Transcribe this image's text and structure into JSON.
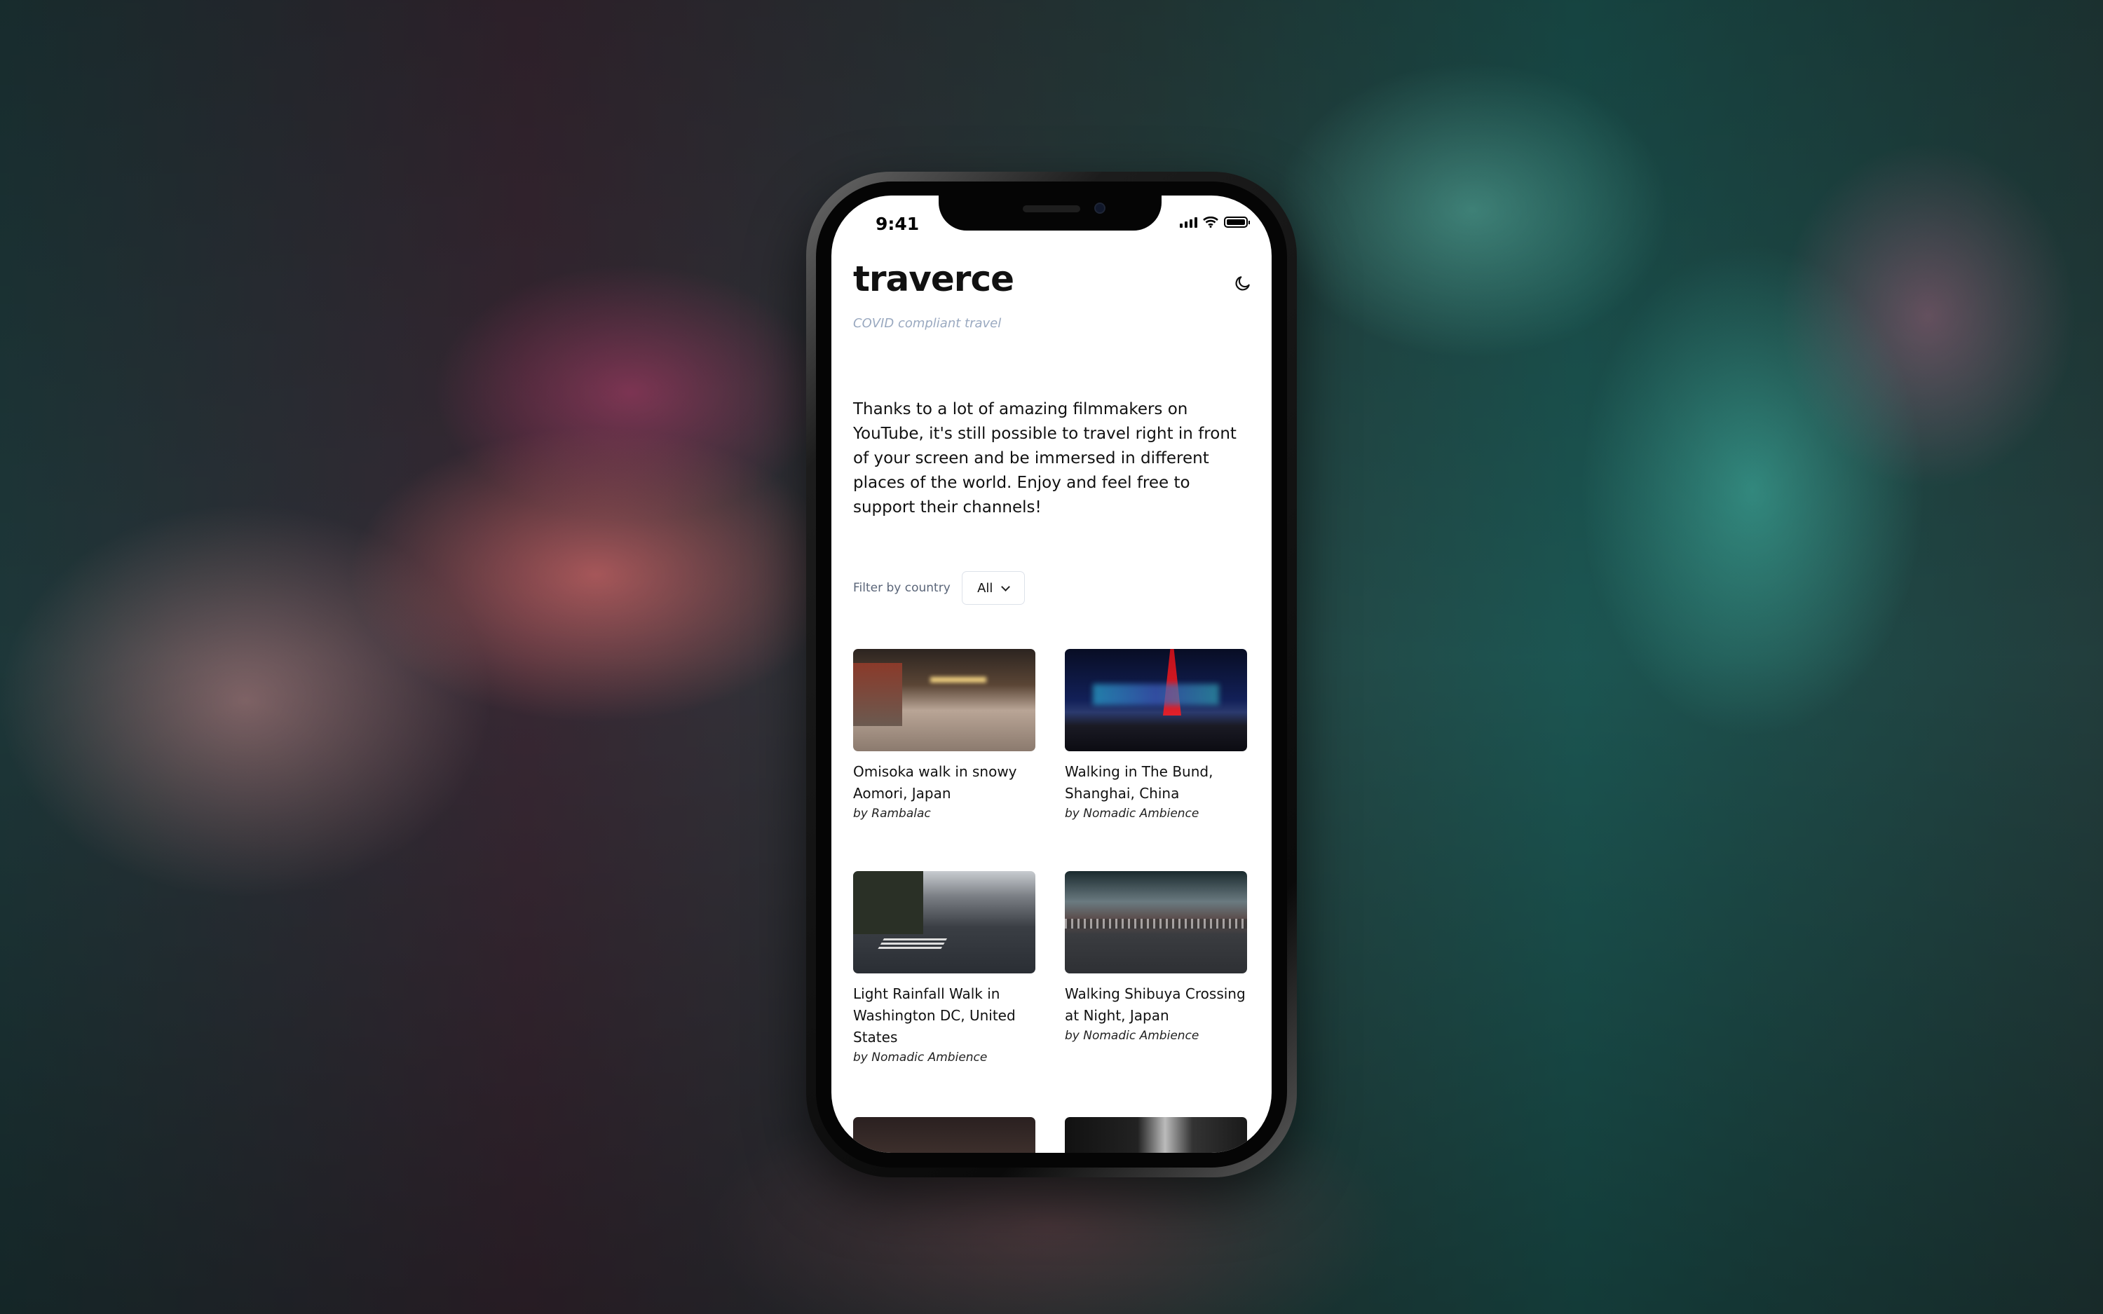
{
  "status_bar": {
    "time": "9:41"
  },
  "header": {
    "title": "traverce",
    "subtitle": "COVID compliant travel",
    "theme_toggle_icon": "moon-icon"
  },
  "intro": "Thanks to a lot of amazing filmmakers on YouTube, it's still possible to travel right in front of your screen and be immersed in different places of the world. Enjoy and feel free to support their channels!",
  "filter": {
    "label": "Filter by country",
    "selected": "All"
  },
  "videos": [
    {
      "title": "Omisoka walk in snowy Aomori, Japan",
      "author": "by Rambalac"
    },
    {
      "title": "Walking in The Bund, Shanghai, China",
      "author": "by Nomadic Ambience"
    },
    {
      "title": "Light Rainfall Walk in Washington DC, United States",
      "author": "by Nomadic Ambience"
    },
    {
      "title": "Walking Shibuya Crossing at Night, Japan",
      "author": "by Nomadic Ambience"
    }
  ]
}
